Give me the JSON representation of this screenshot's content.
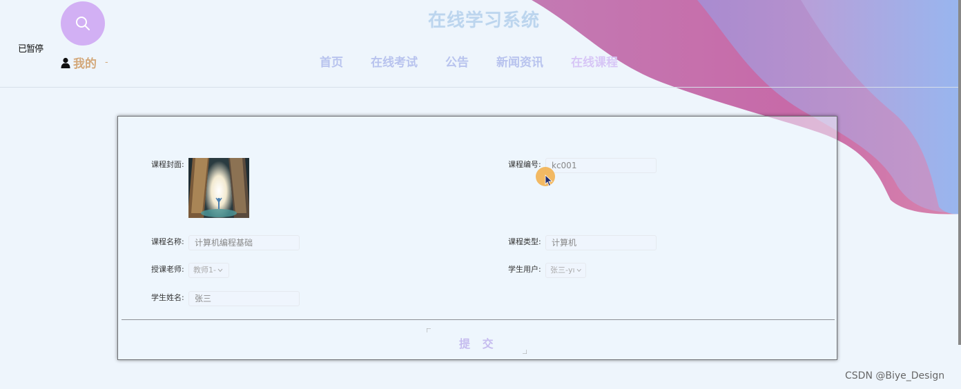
{
  "status_text": "已暂停",
  "site_title": "在线学习系统",
  "user": {
    "label": "我的",
    "suffix": "-"
  },
  "nav": [
    "首页",
    "在线考试",
    "公告",
    "新闻资讯",
    "在线课程"
  ],
  "form": {
    "cover_label": "课程封面:",
    "code_label": "课程编号:",
    "code_value": "kc001",
    "name_label": "课程名称:",
    "name_value": "计算机编程基础",
    "type_label": "课程类型:",
    "type_value": "计算机",
    "teacher_label": "授课老师:",
    "teacher_value": "教师1-",
    "student_user_label": "学生用户:",
    "student_user_value": "张三-yı",
    "student_name_label": "学生姓名:",
    "student_name_value": "张三",
    "submit_label": "提 交"
  },
  "watermark": "CSDN @Biye_Design",
  "colors": {
    "background": "#eef5fc",
    "accent_purple": "#d2b0f4",
    "wave_pink": "#c46bb0",
    "wave_blue": "#9bb8ef",
    "user_label": "#d3a87a",
    "nav_text": "#b8c3ee"
  }
}
